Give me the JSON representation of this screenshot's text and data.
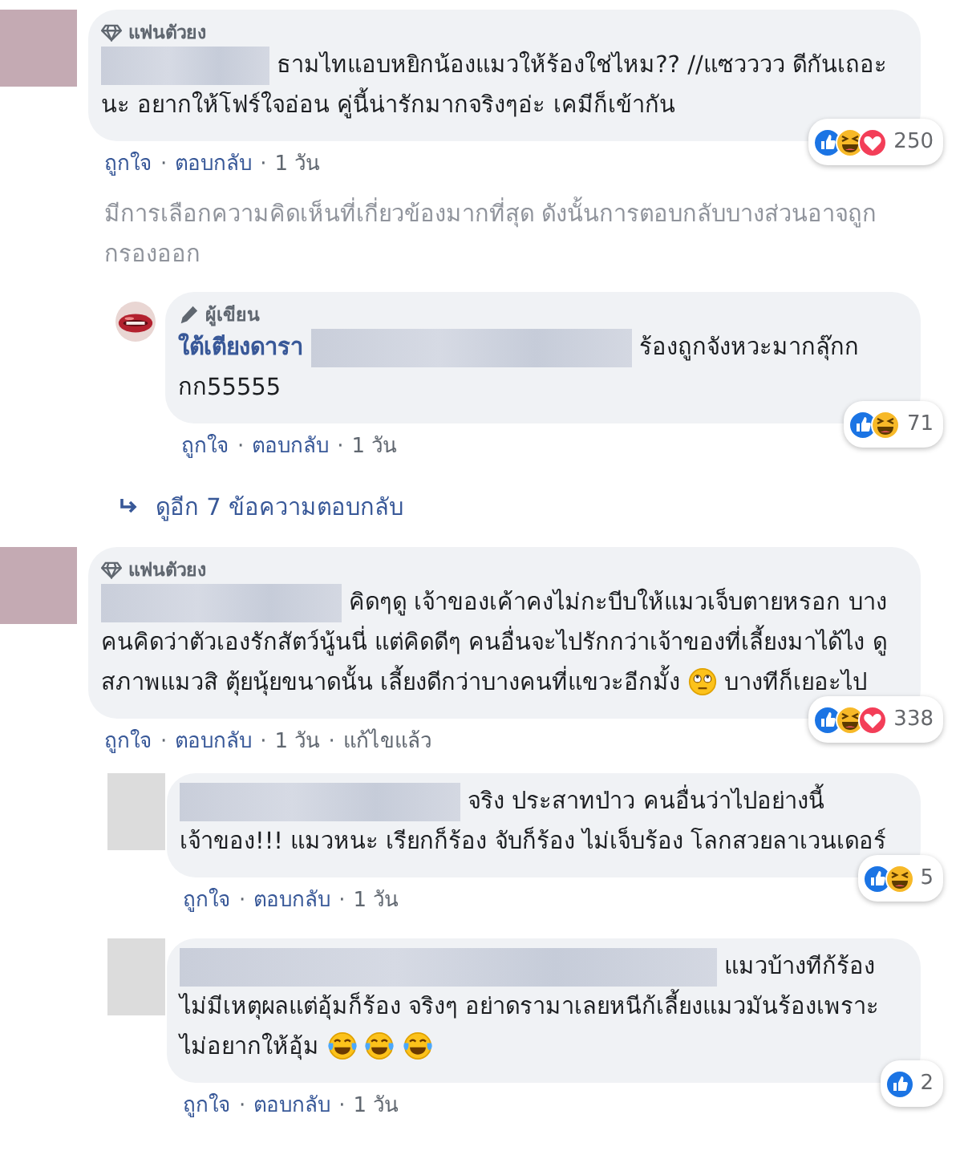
{
  "action_separator": "·",
  "comments": [
    {
      "avatar": {
        "kind": "blurred"
      },
      "badge": {
        "kind": "fan",
        "label": "แฟนตัวยง"
      },
      "body": [
        {
          "kind": "redacted"
        },
        {
          "kind": "text",
          "text": "ธามไทแอบหยิกน้องแมวให้ร้องใช่ไหม?? //แซวววว ดีกันเถอะนะ อยากให้โฟร์ใจอ่อน คู่นี้น่ารักมากจริงๆอ่ะ เคมีก็เข้ากัน"
        }
      ],
      "reactions": [
        {
          "kind": "like"
        },
        {
          "kind": "haha"
        },
        {
          "kind": "love"
        }
      ],
      "reaction_count": "250",
      "actions": [
        "ถูกใจ",
        "ตอบกลับ",
        "1 วัน"
      ],
      "notice": "มีการเลือกความคิดเห็นที่เกี่ยวข้องมากที่สุด ดังนั้นการตอบกลับบางส่วนอาจถูกกรองออก",
      "replies": [
        {
          "avatar": {
            "kind": "picture"
          },
          "badge": {
            "kind": "author",
            "label": "ผู้เขียน"
          },
          "name": "ใต้เตียงดารา",
          "body": [
            {
              "kind": "redacted"
            },
            {
              "kind": "text",
              "text": "ร้องถูกจังหวะมากลุ๊กกกก55555"
            }
          ],
          "reactions": [
            {
              "kind": "like"
            },
            {
              "kind": "haha"
            }
          ],
          "reaction_count": "71",
          "actions": [
            "ถูกใจ",
            "ตอบกลับ",
            "1 วัน"
          ]
        }
      ],
      "more_replies": "ดูอีก 7 ข้อความตอบกลับ"
    },
    {
      "avatar": {
        "kind": "blurred"
      },
      "badge": {
        "kind": "fan",
        "label": "แฟนตัวยง"
      },
      "body": [
        {
          "kind": "redacted"
        },
        {
          "kind": "text",
          "text": "คิดๆดู เจ้าของเค้าคงไม่กะบีบให้แมวเจ็บตายหรอก บางคนคิดว่าตัวเองรักสัตว์นู้นนี่ แต่คิดดีๆ คนอื่นจะไปรักกว่าเจ้าของที่เลี้ยงมาได้ไง ดูสภาพแมวสิ ตุ้ยนุ้ยขนาดนั้น เลี้ยงดีกว่าบางคนที่แขวะอีกมั้ง"
        },
        {
          "kind": "eye-roll-emoji"
        },
        {
          "kind": "text",
          "text": "บางทีก็เยอะไป"
        }
      ],
      "reactions": [
        {
          "kind": "like"
        },
        {
          "kind": "haha"
        },
        {
          "kind": "love"
        }
      ],
      "reaction_count": "338",
      "actions": [
        "ถูกใจ",
        "ตอบกลับ",
        "1 วัน",
        "แก้ไขแล้ว"
      ],
      "replies": [
        {
          "avatar": {
            "kind": "blurred"
          },
          "body": [
            {
              "kind": "redacted"
            },
            {
              "kind": "text",
              "text": "จริง ประสาทป่าว คนอื่นว่าไปอย่างนี้เจ้าของ!!! แมวหนะ เรียกก็ร้อง จับก็ร้อง ไม่เจ็บร้อง โลกสวยลาเวนเดอร์"
            }
          ],
          "reactions": [
            {
              "kind": "like"
            },
            {
              "kind": "haha"
            }
          ],
          "reaction_count": "5",
          "actions": [
            "ถูกใจ",
            "ตอบกลับ",
            "1 วัน"
          ]
        },
        {
          "avatar": {
            "kind": "blurred"
          },
          "body": [
            {
              "kind": "redacted"
            },
            {
              "kind": "text",
              "text": "แมวบ้างทีก้ร้องไม่มีเหตุผลแต่อุ้มก็ร้อง จริงๆ อย่าดรามาเลยหนีก้เลี้ยงแมวมันร้องเพราะไม่อยากให้อุ้ม"
            },
            {
              "kind": "tears-of-joy-emoji"
            },
            {
              "kind": "tears-of-joy-emoji"
            },
            {
              "kind": "tears-of-joy-emoji"
            }
          ],
          "reactions": [
            {
              "kind": "like"
            }
          ],
          "reaction_count": "2",
          "actions": [
            "ถูกใจ",
            "ตอบกลับ",
            "1 วัน"
          ]
        }
      ]
    }
  ]
}
